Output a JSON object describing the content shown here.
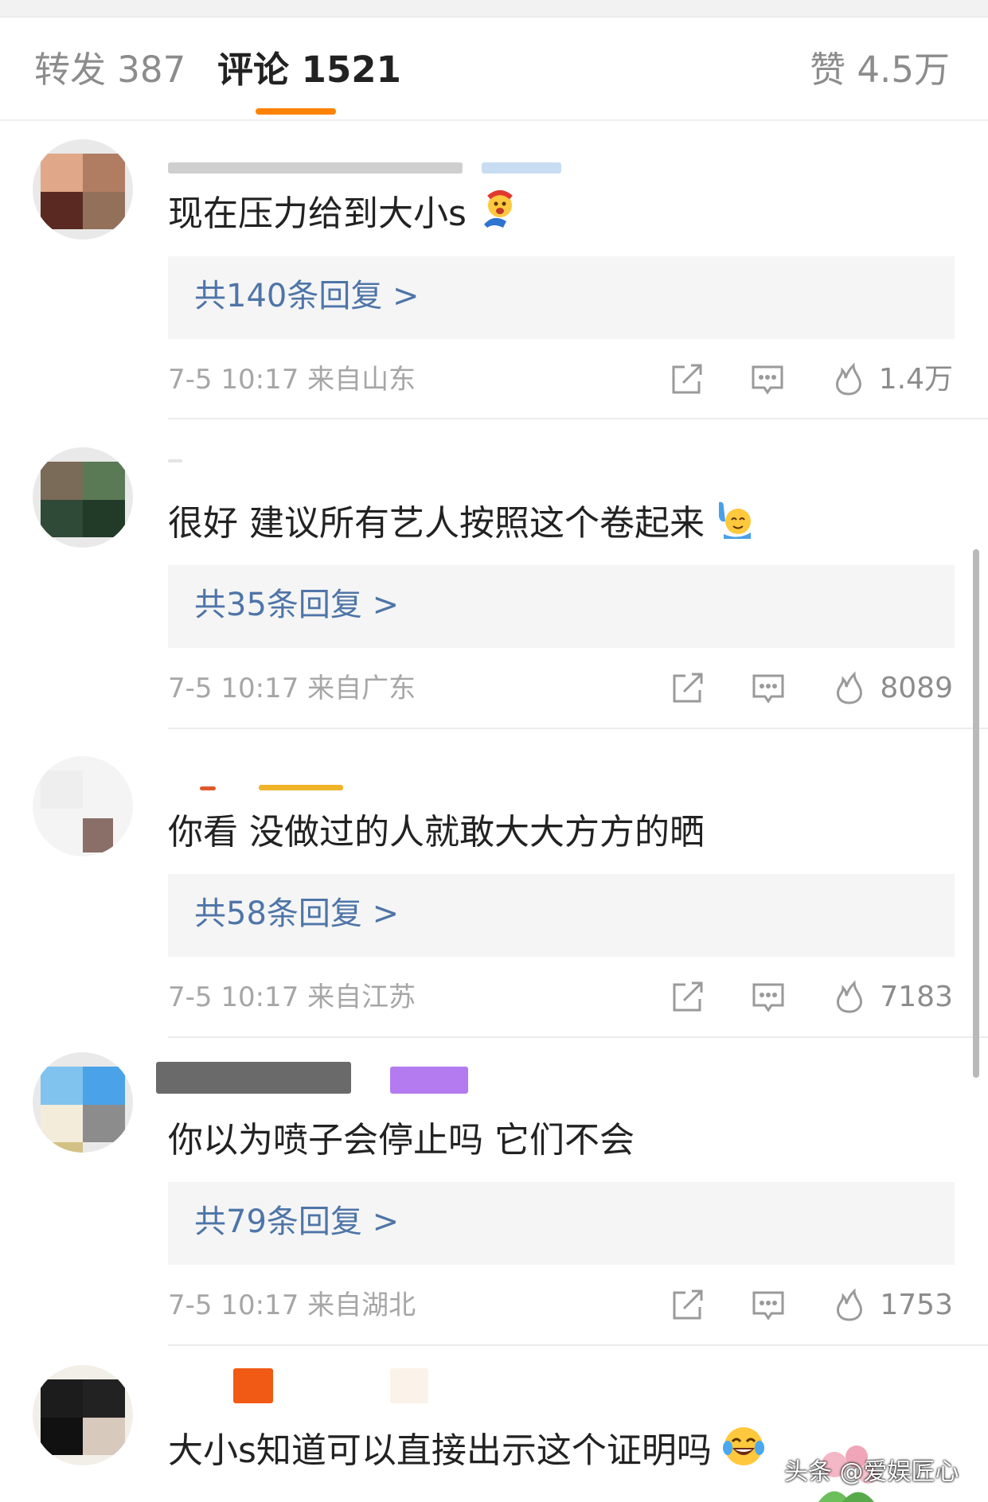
{
  "tabs": {
    "forward": "转发 387",
    "comments": "评论 1521",
    "likes": "赞 4.5万"
  },
  "comments": [
    {
      "text": "现在压力给到大小s",
      "emoji": "excited-face",
      "replies_label": "共140条回复 >",
      "meta": "7-5 10:17 来自山东",
      "like_count": "1.4万"
    },
    {
      "text": "很好 建议所有艺人按照这个卷起来",
      "emoji": "raising-hand-face",
      "replies_label": "共35条回复 >",
      "meta": "7-5 10:17 来自广东",
      "like_count": "8089"
    },
    {
      "text": "你看 没做过的人就敢大大方方的晒",
      "emoji": "",
      "replies_label": "共58条回复 >",
      "meta": "7-5 10:17 来自江苏",
      "like_count": "7183"
    },
    {
      "text": "你以为喷子会停止吗 它们不会",
      "emoji": "",
      "replies_label": "共79条回复 >",
      "meta": "7-5 10:17 来自湖北",
      "like_count": "1753"
    },
    {
      "text": "大小s知道可以直接出示这个证明吗",
      "emoji": "tears-of-joy-face"
    }
  ],
  "watermark": "头条 @爱娱匠心",
  "colors": {
    "accent": "#ff8200",
    "link": "#4e75a8",
    "meta": "#a6a6a6",
    "reply_bg": "#f5f5f5"
  }
}
